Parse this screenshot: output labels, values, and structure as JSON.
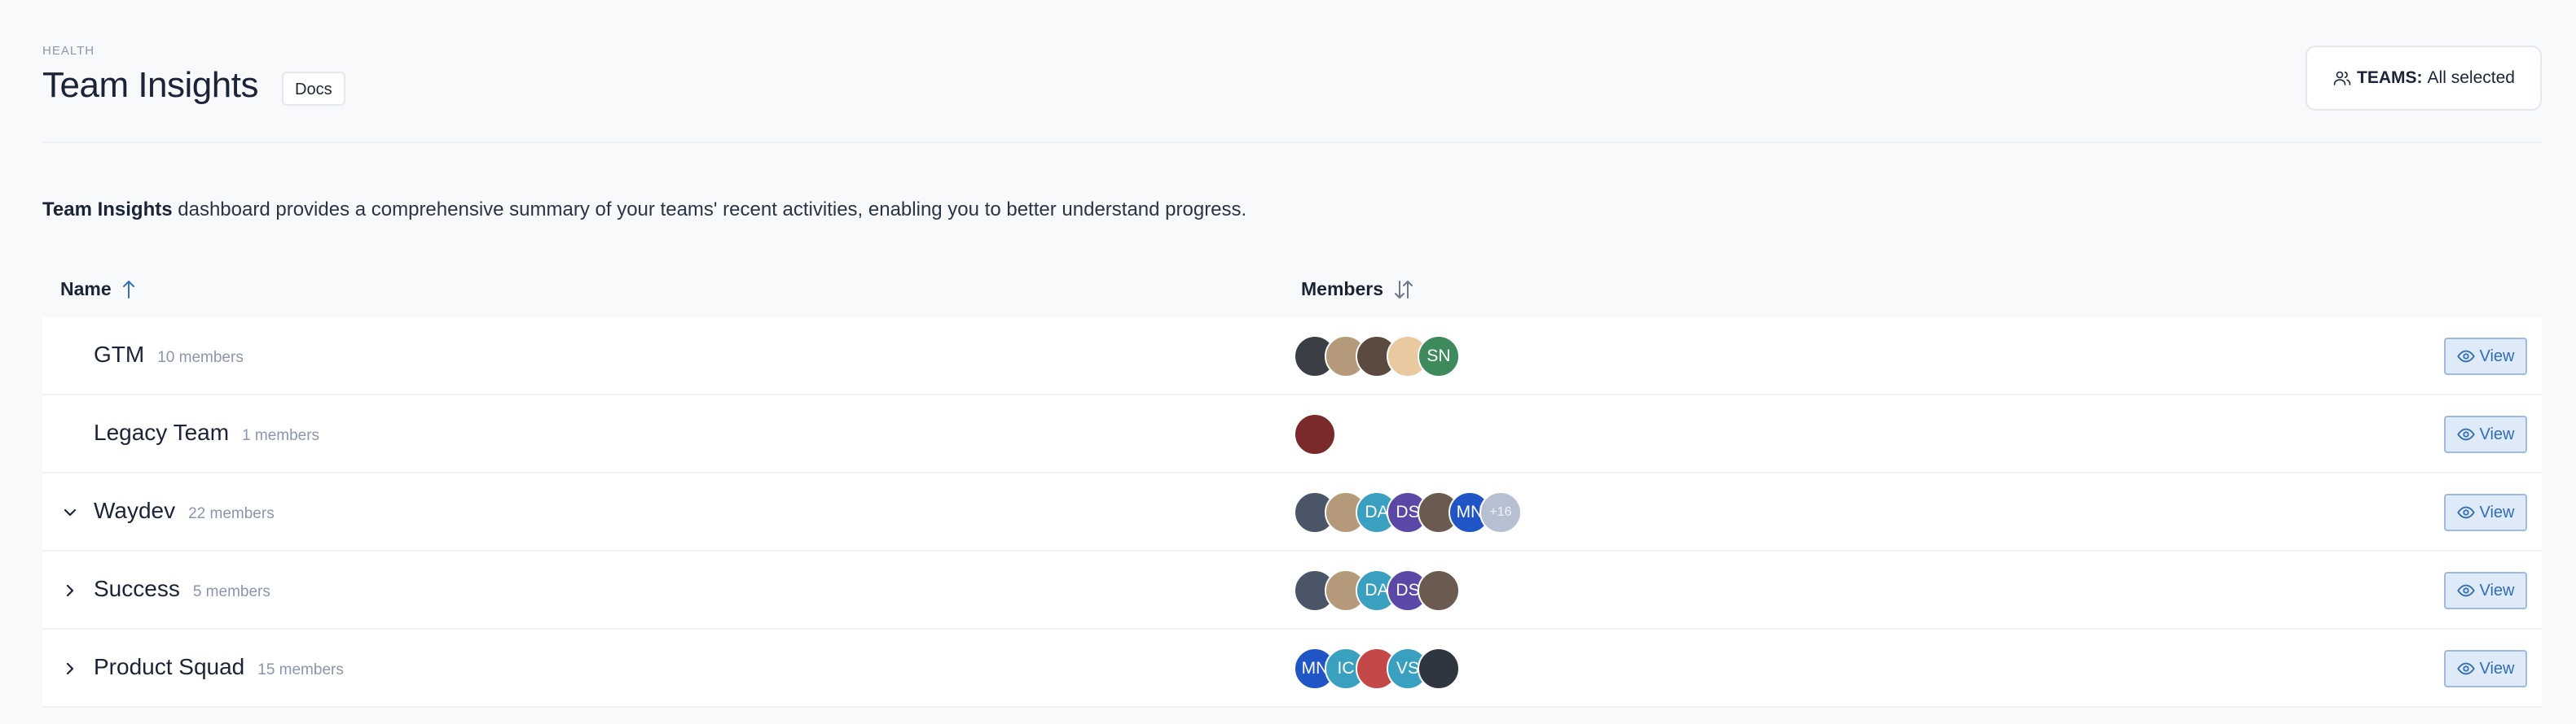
{
  "header": {
    "eyebrow": "HEALTH",
    "title": "Team Insights",
    "docs_label": "Docs",
    "teams_filter": {
      "label": "TEAMS:",
      "value": "All selected",
      "icon": "users-icon"
    }
  },
  "intro": {
    "bold": "Team Insights",
    "text": " dashboard provides a comprehensive summary of your teams' recent activities, enabling you to better understand progress."
  },
  "table": {
    "columns": [
      {
        "label": "Name",
        "sort_icon": "arrow-up-icon"
      },
      {
        "label": "Members",
        "sort_icon": "sort-icon"
      }
    ],
    "view_label": "View",
    "rows": [
      {
        "name": "GTM",
        "count": "10 members",
        "expander": "none",
        "avatars": [
          {
            "text": "",
            "color": "#3b3f45"
          },
          {
            "text": "",
            "color": "#b49a7a"
          },
          {
            "text": "",
            "color": "#5a4a3f"
          },
          {
            "text": "",
            "color": "#e8c9a0"
          },
          {
            "text": "SN",
            "color": "#3e8a5c"
          }
        ]
      },
      {
        "name": "Legacy Team",
        "count": "1 members",
        "expander": "none",
        "avatars": [
          {
            "text": "",
            "color": "#7a2a2a"
          }
        ]
      },
      {
        "name": "Waydev",
        "count": "22 members",
        "expander": "expanded",
        "avatars": [
          {
            "text": "",
            "color": "#4a5568"
          },
          {
            "text": "",
            "color": "#b49a7a"
          },
          {
            "text": "DA",
            "color": "#3aa0c0"
          },
          {
            "text": "DS",
            "color": "#5b47a6"
          },
          {
            "text": "",
            "color": "#6b5a50"
          },
          {
            "text": "MN",
            "color": "#1f55c4"
          },
          {
            "text": "+16",
            "color": "#b6c0d0"
          }
        ]
      },
      {
        "name": "Success",
        "count": "5 members",
        "expander": "collapsed",
        "avatars": [
          {
            "text": "",
            "color": "#4a5568"
          },
          {
            "text": "",
            "color": "#b49a7a"
          },
          {
            "text": "DA",
            "color": "#3aa0c0"
          },
          {
            "text": "DS",
            "color": "#5b47a6"
          },
          {
            "text": "",
            "color": "#6b5a50"
          }
        ]
      },
      {
        "name": "Product Squad",
        "count": "15 members",
        "expander": "collapsed",
        "avatars": [
          {
            "text": "MN",
            "color": "#1f55c4"
          },
          {
            "text": "IC",
            "color": "#3aa0c0"
          },
          {
            "text": "",
            "color": "#c44848"
          },
          {
            "text": "VS",
            "color": "#3aa0c0"
          },
          {
            "text": "",
            "color": "#2f3640"
          }
        ]
      }
    ]
  }
}
